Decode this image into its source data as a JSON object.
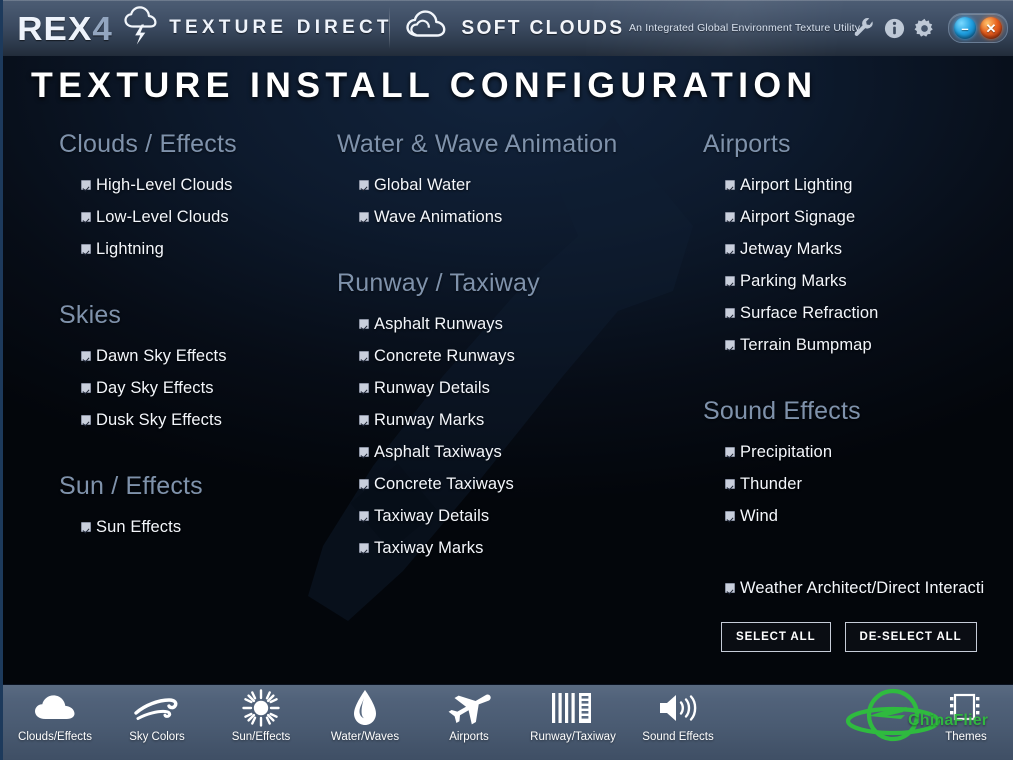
{
  "titlebar": {
    "brand": "REX",
    "brand_version": "4",
    "product": "TEXTURE DIRECT",
    "company": "SOFT CLOUDS",
    "tagline": "An Integrated Global Environment Texture Utility",
    "icons": [
      "wrench-icon",
      "info-icon",
      "gear-icon"
    ],
    "minimize_label": "–",
    "close_label": "✕",
    "accent_blue": "#1f9fe0",
    "accent_orange": "#e8601f"
  },
  "page": {
    "title": "TEXTURE INSTALL CONFIGURATION"
  },
  "groups": [
    {
      "id": "clouds-effects",
      "title": "Clouds / Effects",
      "options": [
        {
          "label": "High-Level Clouds",
          "checked": true
        },
        {
          "label": "Low-Level Clouds",
          "checked": true
        },
        {
          "label": "Lightning",
          "checked": true
        }
      ]
    },
    {
      "id": "skies",
      "title": "Skies",
      "options": [
        {
          "label": "Dawn Sky Effects",
          "checked": true
        },
        {
          "label": "Day Sky Effects",
          "checked": true
        },
        {
          "label": "Dusk Sky Effects",
          "checked": true
        }
      ]
    },
    {
      "id": "sun-effects",
      "title": "Sun / Effects",
      "options": [
        {
          "label": "Sun Effects",
          "checked": true
        }
      ]
    },
    {
      "id": "water-wave-animation",
      "title": "Water & Wave Animation",
      "options": [
        {
          "label": "Global Water",
          "checked": true
        },
        {
          "label": "Wave Animations",
          "checked": true
        }
      ]
    },
    {
      "id": "runway-taxiway",
      "title": "Runway / Taxiway",
      "options": [
        {
          "label": "Asphalt Runways",
          "checked": true
        },
        {
          "label": "Concrete Runways",
          "checked": true
        },
        {
          "label": "Runway Details",
          "checked": true
        },
        {
          "label": "Runway Marks",
          "checked": true
        },
        {
          "label": "Asphalt Taxiways",
          "checked": true
        },
        {
          "label": "Concrete Taxiways",
          "checked": true
        },
        {
          "label": "Taxiway Details",
          "checked": true
        },
        {
          "label": "Taxiway Marks",
          "checked": true
        }
      ]
    },
    {
      "id": "airports",
      "title": "Airports",
      "options": [
        {
          "label": "Airport Lighting",
          "checked": true
        },
        {
          "label": "Airport Signage",
          "checked": true
        },
        {
          "label": "Jetway Marks",
          "checked": true
        },
        {
          "label": "Parking Marks",
          "checked": true
        },
        {
          "label": "Surface Refraction",
          "checked": true
        },
        {
          "label": "Terrain Bumpmap",
          "checked": true
        }
      ]
    },
    {
      "id": "sound-effects",
      "title": "Sound Effects",
      "options": [
        {
          "label": "Precipitation",
          "checked": true
        },
        {
          "label": "Thunder",
          "checked": true
        },
        {
          "label": "Wind",
          "checked": true
        }
      ]
    }
  ],
  "weather_architect": {
    "label": "Weather Architect/Direct Interacti",
    "checked": true
  },
  "actions": {
    "select_all": "SELECT ALL",
    "deselect_all": "DE-SELECT ALL"
  },
  "footer_nav": [
    {
      "label": "Clouds/Effects",
      "icon": "cloud-icon"
    },
    {
      "label": "Sky Colors",
      "icon": "wind-icon"
    },
    {
      "label": "Sun/Effects",
      "icon": "sun-icon"
    },
    {
      "label": "Water/Waves",
      "icon": "water-drop-icon"
    },
    {
      "label": "Airports",
      "icon": "airplane-icon"
    },
    {
      "label": "Runway/Taxiway",
      "icon": "runway-icon"
    },
    {
      "label": "Sound Effects",
      "icon": "speaker-icon"
    },
    {
      "label": "Themes",
      "icon": "themes-icon"
    }
  ],
  "watermark": {
    "text": "ChinaFlier",
    "color": "#2fbb3f"
  }
}
